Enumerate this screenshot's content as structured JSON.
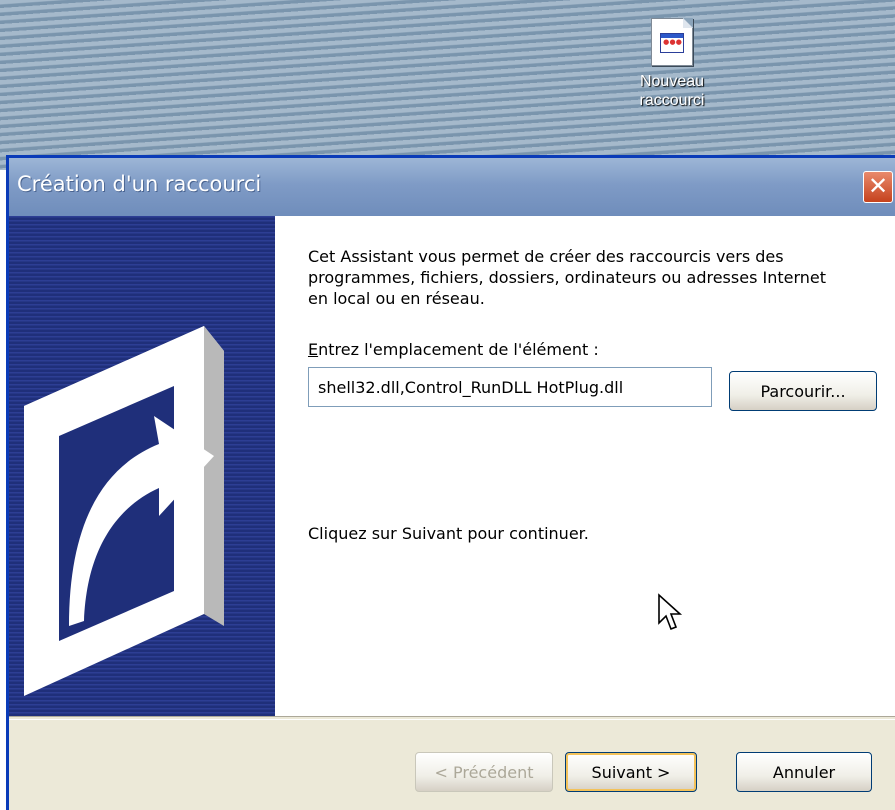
{
  "desktop": {
    "icon_label_line1": "Nouveau",
    "icon_label_line2": "raccourci",
    "icon": "shortcut-file-icon"
  },
  "dialog": {
    "title": "Création d'un raccourci",
    "close_icon": "close-icon",
    "intro": "Cet Assistant vous permet de créer des raccourcis vers des programmes, fichiers, dossiers, ordinateurs ou adresses Internet en local ou en réseau.",
    "field_label_accel": "E",
    "field_label_rest": "ntrez l'emplacement de l'élément :",
    "location_value": "shell32.dll,Control_RunDLL HotPlug.dll",
    "browse_label": "Parcourir...",
    "continue_text": "Cliquez sur Suivant pour continuer.",
    "buttons": {
      "previous": "< Précédent",
      "next": "Suivant >",
      "cancel": "Annuler"
    },
    "colors": {
      "title_bar": "#7f9bc6",
      "banner": "#1f2f7a",
      "close": "#c5421d",
      "face": "#ece9d8"
    }
  }
}
